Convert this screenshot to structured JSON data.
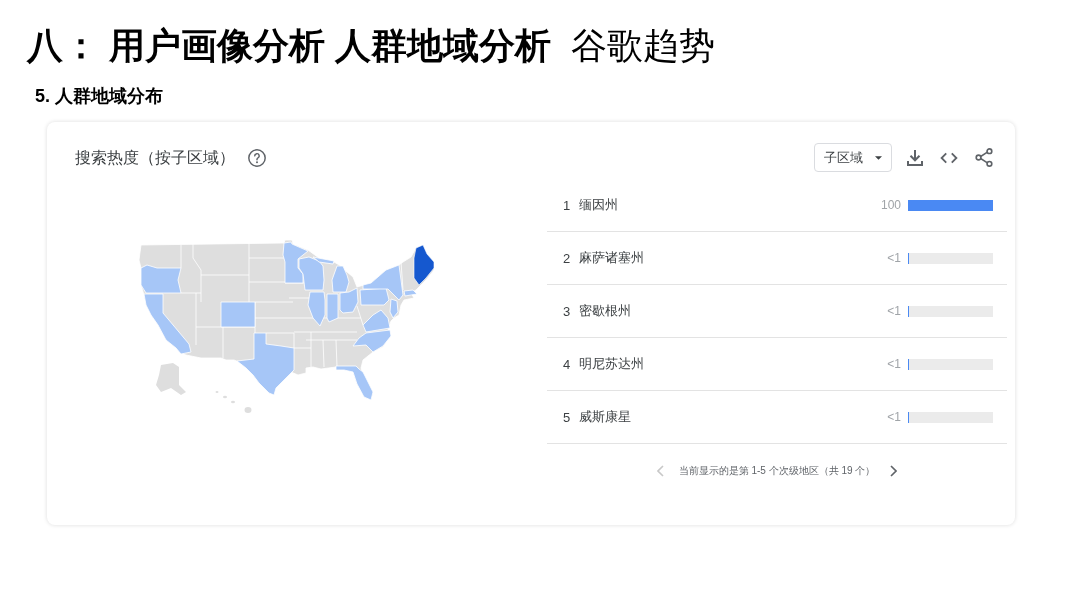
{
  "slide": {
    "title": "**八： 用户画像分析 人群地域分析**  谷歌趋势",
    "subtitle": "5. 人群地域分布"
  },
  "card": {
    "title": "搜索热度（按子区域）",
    "region_dropdown": {
      "label": "子区域"
    },
    "regions": [
      {
        "rank": "1",
        "name": "缅因州",
        "value": "100",
        "level": 1
      },
      {
        "rank": "2",
        "name": "麻萨诸塞州",
        "value": "<1",
        "level": 0.01
      },
      {
        "rank": "3",
        "name": "密歇根州",
        "value": "<1",
        "level": 0.01
      },
      {
        "rank": "4",
        "name": "明尼苏达州",
        "value": "<1",
        "level": 0.01
      },
      {
        "rank": "5",
        "name": "威斯康星",
        "value": "<1",
        "level": 0.01
      }
    ],
    "pager": {
      "label": "当前显示的是第 1-5 个次级地区（共 19 个）",
      "previous": {
        "disabled": true
      },
      "next": {
        "disabled": false
      }
    }
  }
}
